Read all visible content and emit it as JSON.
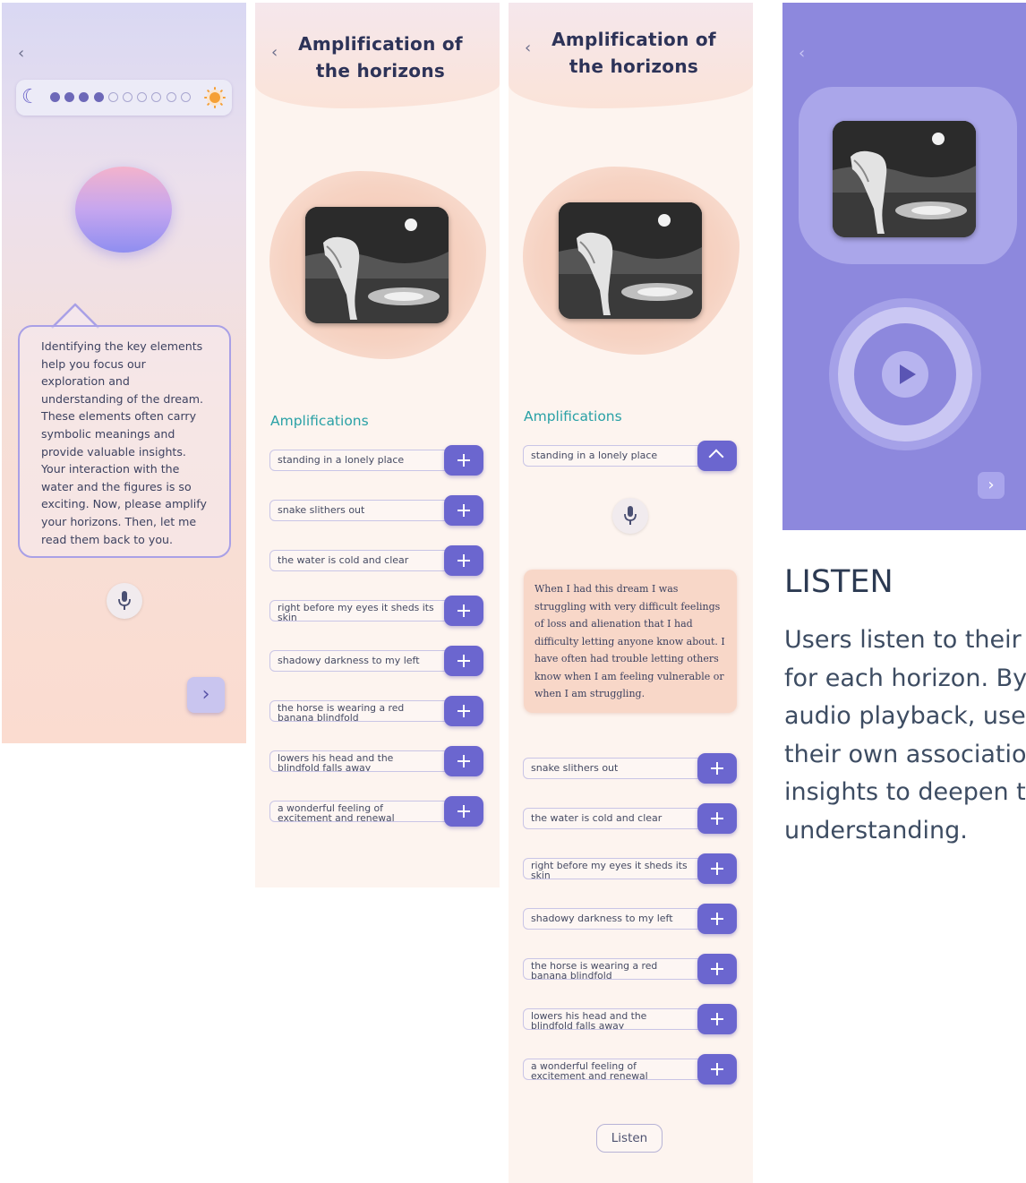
{
  "screen1": {
    "back_icon": "‹",
    "progress": {
      "total_steps": 11,
      "completed_steps": 4,
      "start_icon": "moon-icon",
      "end_icon": "sun-icon"
    },
    "guide_text": [
      "Identifying the key elements",
      "help you focus our",
      "exploration and",
      "understanding of the dream.",
      "These elements often carry",
      "symbolic meanings and",
      "provide valuable insights.",
      "Your interaction with the",
      "water and the figures is so",
      "exciting. Now, please amplify",
      "your horizons. Then, let me",
      "read them back to you."
    ],
    "mic_icon": "microphone-icon",
    "next_icon": "›"
  },
  "screen2": {
    "back_icon": "‹",
    "title_line1": "Amplification of",
    "title_line2": "the horizons",
    "section_title": "Amplifications",
    "items": [
      [
        "standing in a lonely place"
      ],
      [
        "snake slithers out"
      ],
      [
        "the water is cold and clear"
      ],
      [
        "right before my eyes it sheds its",
        "skin"
      ],
      [
        "shadowy darkness to my left"
      ],
      [
        "the horse is wearing a red",
        "banana blindfold"
      ],
      [
        "lowers his head and the",
        "blindfold falls away"
      ],
      [
        "a wonderful feeling of",
        "excitement and renewal"
      ]
    ]
  },
  "screen3": {
    "back_icon": "‹",
    "title_line1": "Amplification of",
    "title_line2": "the horizons",
    "section_title": "Amplifications",
    "expanded_item": "standing in a lonely place",
    "note_lines": [
      "When I had this dream I was",
      "struggling with very difficult feelings",
      "of loss and alienation that I had",
      "difficulty letting anyone know about. I",
      "have often had trouble letting others",
      "know when I am feeling vulnerable or",
      "when I am struggling."
    ],
    "items": [
      [
        "snake slithers out"
      ],
      [
        "the water is cold and clear"
      ],
      [
        "right before my eyes it sheds its",
        "skin"
      ],
      [
        "shadowy darkness to my left"
      ],
      [
        "the horse is wearing a red",
        "banana blindfold"
      ],
      [
        "lowers his head and the",
        "blindfold falls away"
      ],
      [
        "a wonderful feeling of",
        "excitement and renewal"
      ]
    ],
    "listen_label": "Listen"
  },
  "screen4": {
    "back_icon": "‹",
    "play_icon": "play-icon",
    "next_icon": "›"
  },
  "description": {
    "heading": "LISTEN",
    "body_lines": [
      "Users listen to their",
      "for each horizon. By",
      "audio playback, use",
      "their own associatio",
      "insights to deepen t",
      "understanding."
    ]
  },
  "colors": {
    "accent": "#6b66cf",
    "teal": "#2aa1a6",
    "listen_bg": "#8d88dd",
    "peach": "#f8d7c8"
  }
}
